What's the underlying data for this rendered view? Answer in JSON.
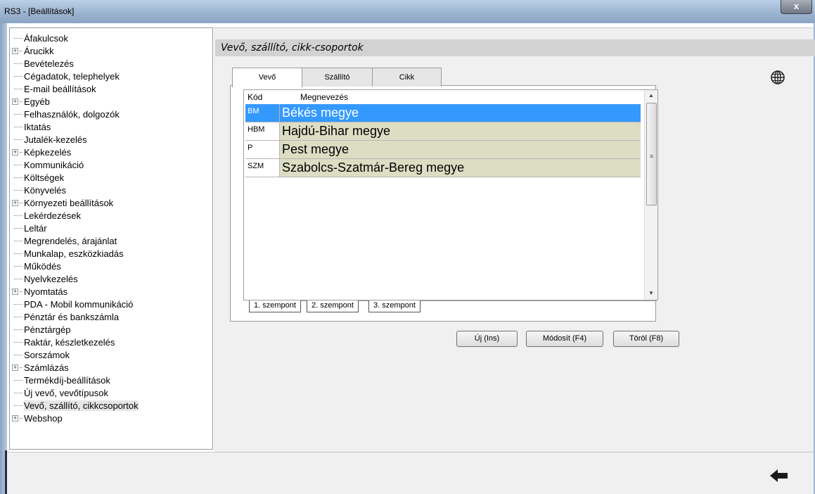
{
  "window": {
    "title": "RS3 - [Beállítások]",
    "close_label": "x"
  },
  "tree": {
    "items": [
      {
        "label": "Áfakulcsok",
        "expandable": false
      },
      {
        "label": "Árucikk",
        "expandable": true
      },
      {
        "label": "Bevételezés",
        "expandable": false
      },
      {
        "label": "Cégadatok, telephelyek",
        "expandable": false
      },
      {
        "label": "E-mail beállítások",
        "expandable": false
      },
      {
        "label": "Egyéb",
        "expandable": true
      },
      {
        "label": "Felhasználók, dolgozók",
        "expandable": false
      },
      {
        "label": "Iktatás",
        "expandable": false
      },
      {
        "label": "Jutalék-kezelés",
        "expandable": false
      },
      {
        "label": "Képkezelés",
        "expandable": true
      },
      {
        "label": "Kommunikáció",
        "expandable": false
      },
      {
        "label": "Költségek",
        "expandable": false
      },
      {
        "label": "Könyvelés",
        "expandable": false
      },
      {
        "label": "Környezeti beállítások",
        "expandable": true
      },
      {
        "label": "Lekérdezések",
        "expandable": false
      },
      {
        "label": "Leltár",
        "expandable": false
      },
      {
        "label": "Megrendelés, árajánlat",
        "expandable": false
      },
      {
        "label": "Munkalap, eszközkiadás",
        "expandable": false
      },
      {
        "label": "Működés",
        "expandable": false
      },
      {
        "label": "Nyelvkezelés",
        "expandable": false
      },
      {
        "label": "Nyomtatás",
        "expandable": true
      },
      {
        "label": "PDA - Mobil kommunikáció",
        "expandable": false
      },
      {
        "label": "Pénztár és bankszámla",
        "expandable": false
      },
      {
        "label": "Pénztárgép",
        "expandable": false
      },
      {
        "label": "Raktár, készletkezelés",
        "expandable": false
      },
      {
        "label": "Sorszámok",
        "expandable": false
      },
      {
        "label": "Számlázás",
        "expandable": true
      },
      {
        "label": "Termékdíj-beállítások",
        "expandable": false
      },
      {
        "label": "Új vevő, vevőtípusok",
        "expandable": false
      },
      {
        "label": "Vevő, szállító, cikkcsoportok",
        "expandable": false,
        "selected": true
      },
      {
        "label": "Webshop",
        "expandable": true
      }
    ]
  },
  "section": {
    "title": "Vevő, szállító, cikk-csoportok"
  },
  "tabs": [
    "Vevő",
    "Szállító",
    "Cikk"
  ],
  "grid": {
    "headers": [
      "Kód",
      "Megnevezés"
    ],
    "rows": [
      {
        "code": "BM",
        "name": "Békés megye",
        "selected": true
      },
      {
        "code": "HBM",
        "name": "Hajdú-Bihar megye"
      },
      {
        "code": "P",
        "name": "Pest megye"
      },
      {
        "code": "SZM",
        "name": "Szabolcs-Szatmár-Bereg megye"
      }
    ],
    "scroll_grip": "≡"
  },
  "bottom_tabs": [
    "1. szempont",
    "2. szempont",
    "3. szempont"
  ],
  "buttons": {
    "new": "Új (Ins)",
    "edit": "Módosít (F4)",
    "delete": "Töröl (F8)"
  },
  "colors": {
    "selection": "#3399ff",
    "row_background": "#ddddc4",
    "header_band": "#d2d2d2"
  },
  "icons": {
    "globe": "globe-icon",
    "back": "back-arrow-icon"
  }
}
